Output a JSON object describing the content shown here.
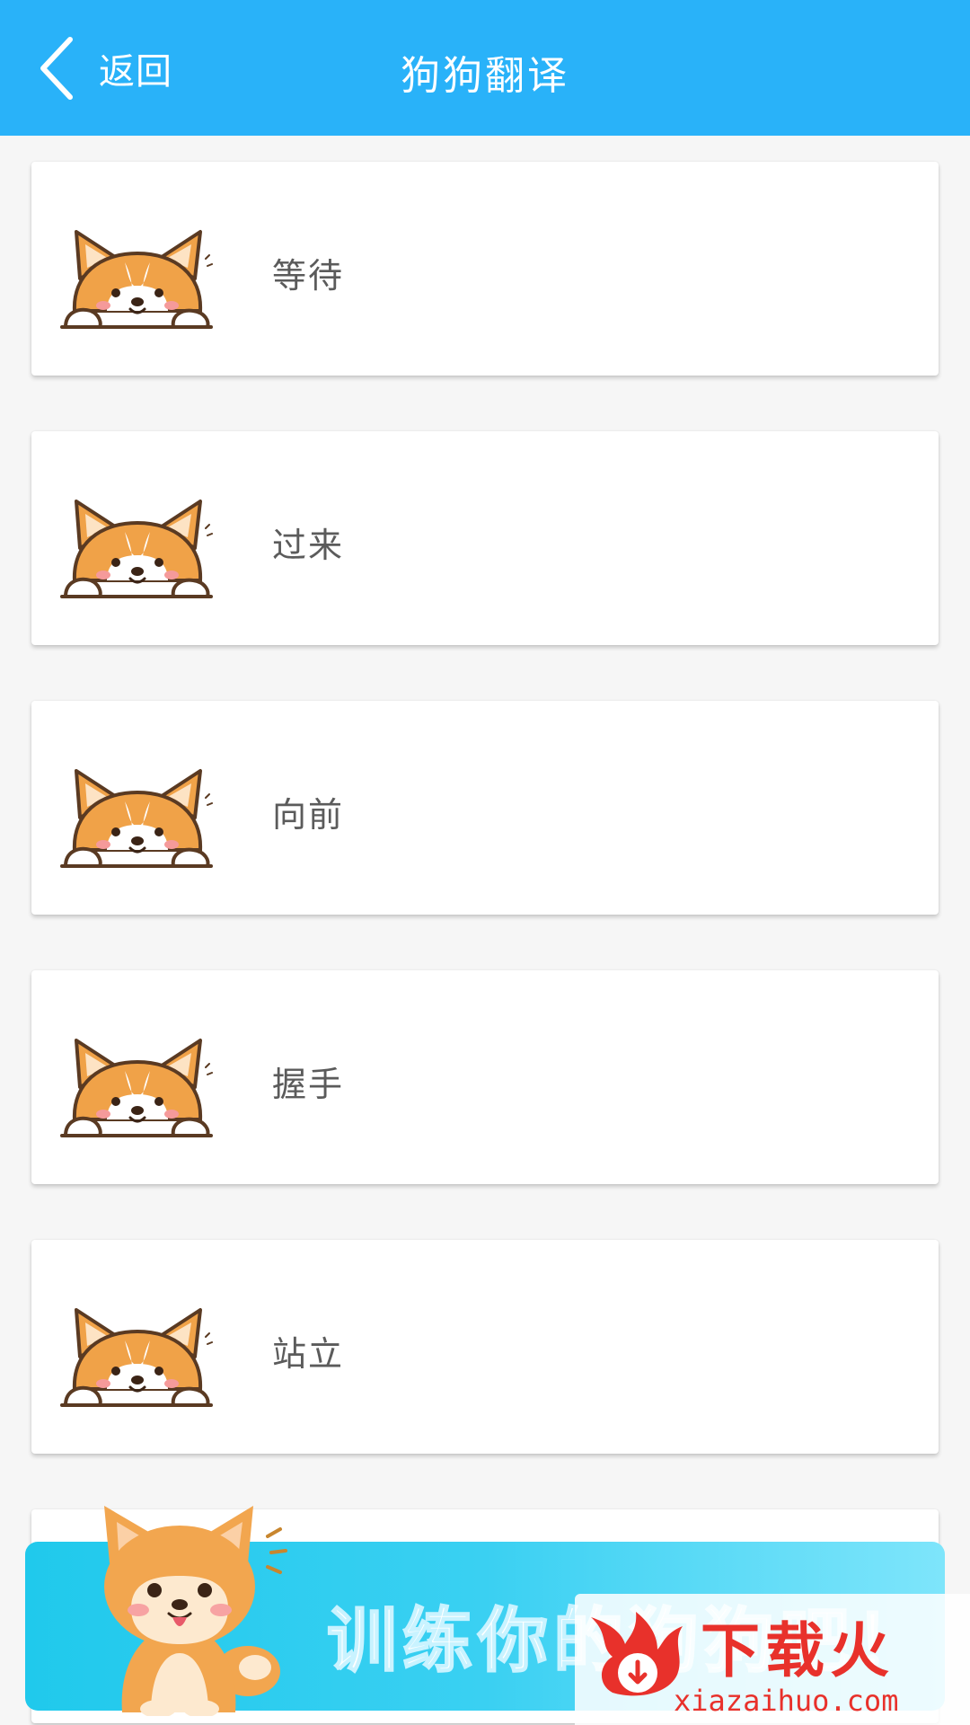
{
  "header": {
    "back_label": "返回",
    "title": "狗狗翻译",
    "background_color": "#29b2f9",
    "back_icon": "chevron-left-icon"
  },
  "commands": [
    {
      "label": "等待",
      "icon": "corgi-icon"
    },
    {
      "label": "过来",
      "icon": "corgi-icon"
    },
    {
      "label": "向前",
      "icon": "corgi-icon"
    },
    {
      "label": "握手",
      "icon": "corgi-icon"
    },
    {
      "label": "站立",
      "icon": "corgi-icon"
    }
  ],
  "banner": {
    "text": "训练你的狗狗吧！",
    "icon": "shiba-dog-icon"
  },
  "watermark": {
    "logo_text": "下载火",
    "url": "xiazaihuo.com"
  }
}
